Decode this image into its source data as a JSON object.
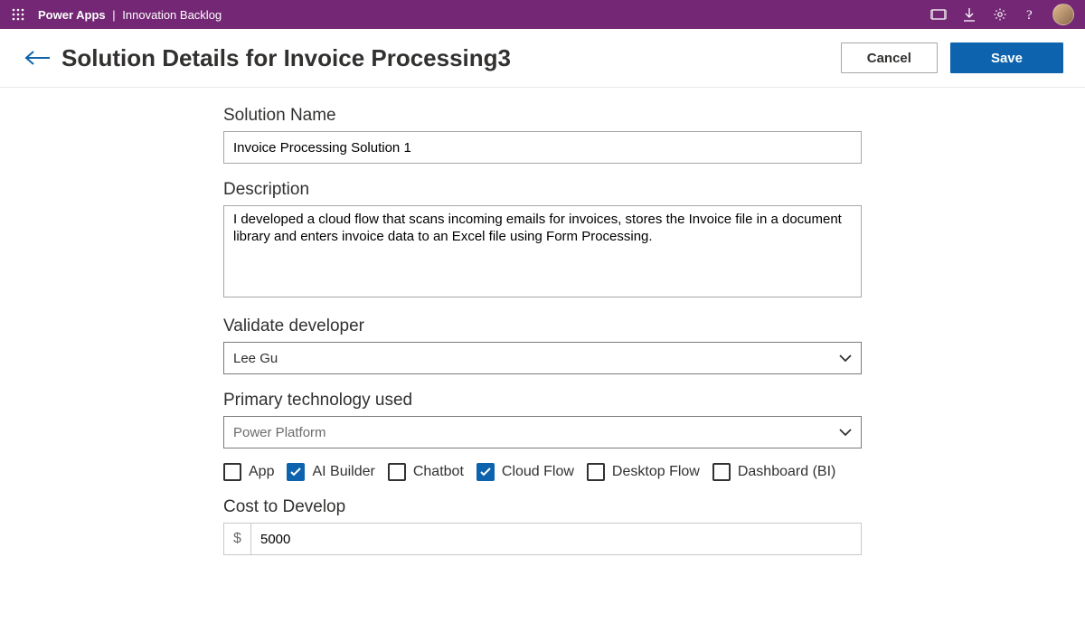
{
  "topbar": {
    "app": "Power Apps",
    "sub": "Innovation Backlog"
  },
  "header": {
    "title": "Solution Details for Invoice Processing3",
    "cancel": "Cancel",
    "save": "Save"
  },
  "form": {
    "solution_name_label": "Solution Name",
    "solution_name_value": "Invoice Processing Solution 1",
    "description_label": "Description",
    "description_value": "I developed a cloud flow that scans incoming emails for invoices, stores the Invoice file in a document library and enters invoice data to an Excel file using Form Processing.",
    "validate_developer_label": "Validate developer",
    "validate_developer_value": "Lee Gu",
    "primary_tech_label": "Primary technology used",
    "primary_tech_value": "Power Platform",
    "checks": {
      "app": "App",
      "ai_builder": "AI Builder",
      "chatbot": "Chatbot",
      "cloud_flow": "Cloud Flow",
      "desktop_flow": "Desktop Flow",
      "dashboard": "Dashboard (BI)"
    },
    "cost_label": "Cost to Develop",
    "cost_currency": "$",
    "cost_value": "5000"
  }
}
